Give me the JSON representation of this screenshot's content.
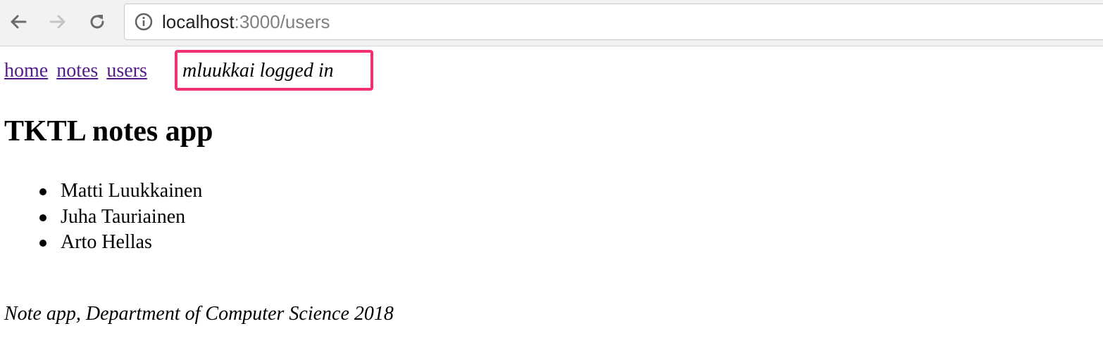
{
  "browser": {
    "back_icon": "arrow-left-icon",
    "forward_icon": "arrow-right-icon",
    "reload_icon": "reload-icon",
    "info_icon": "info-icon",
    "url_host": "localhost",
    "url_path": ":3000/users"
  },
  "nav": {
    "links": [
      {
        "label": "home"
      },
      {
        "label": "notes"
      },
      {
        "label": "users"
      }
    ],
    "logged_in_text": "mluukkai logged in",
    "highlight_color": "#f4306f",
    "link_color": "#551a8b"
  },
  "main": {
    "title": "TKTL notes app",
    "users": [
      {
        "name": "Matti Luukkainen"
      },
      {
        "name": "Juha Tauriainen"
      },
      {
        "name": "Arto Hellas"
      }
    ]
  },
  "footer": {
    "text": "Note app, Department of Computer Science 2018"
  }
}
